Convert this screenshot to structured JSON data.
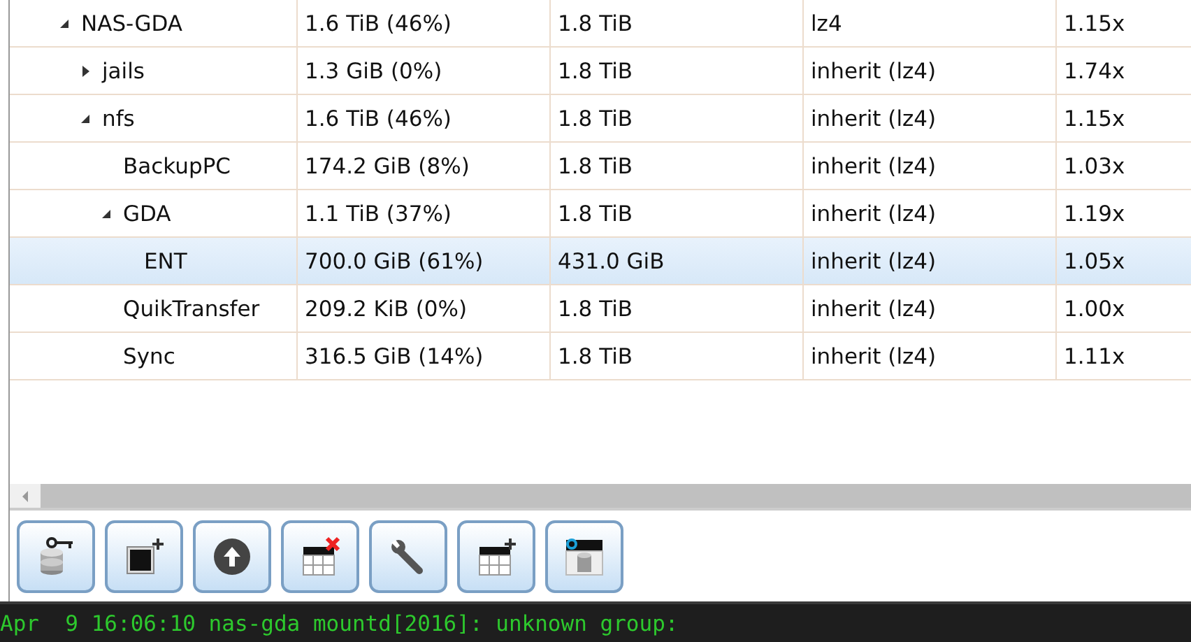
{
  "tree": [
    {
      "name": "NAS-GDA",
      "used": "1.6 TiB (46%)",
      "avail": "1.8 TiB",
      "compression": "lz4",
      "ratio": "1.15x",
      "selected": false,
      "expanded": true,
      "children": [
        {
          "name": "jails",
          "used": "1.3 GiB (0%)",
          "avail": "1.8 TiB",
          "compression": "inherit (lz4)",
          "ratio": "1.74x",
          "selected": false,
          "expanded": false
        },
        {
          "name": "nfs",
          "used": "1.6 TiB (46%)",
          "avail": "1.8 TiB",
          "compression": "inherit (lz4)",
          "ratio": "1.15x",
          "selected": false,
          "expanded": true,
          "children": [
            {
              "name": "BackupPC",
              "used": "174.2 GiB (8%)",
              "avail": "1.8 TiB",
              "compression": "inherit (lz4)",
              "ratio": "1.03x",
              "selected": false
            },
            {
              "name": "GDA",
              "used": "1.1 TiB (37%)",
              "avail": "1.8 TiB",
              "compression": "inherit (lz4)",
              "ratio": "1.19x",
              "selected": false,
              "expanded": true,
              "children": [
                {
                  "name": "ENT",
                  "used": "700.0 GiB (61%)",
                  "avail": "431.0 GiB",
                  "compression": "inherit (lz4)",
                  "ratio": "1.05x",
                  "selected": true
                }
              ]
            },
            {
              "name": "QuikTransfer",
              "used": "209.2 KiB (0%)",
              "avail": "1.8 TiB",
              "compression": "inherit (lz4)",
              "ratio": "1.00x",
              "selected": false
            },
            {
              "name": "Sync",
              "used": "316.5 GiB (14%)",
              "avail": "1.8 TiB",
              "compression": "inherit (lz4)",
              "ratio": "1.11x",
              "selected": false
            }
          ]
        }
      ]
    }
  ],
  "toolbar": [
    {
      "kind": "key-database"
    },
    {
      "kind": "square-plus"
    },
    {
      "kind": "upload"
    },
    {
      "kind": "table-delete"
    },
    {
      "kind": "wrench"
    },
    {
      "kind": "table-plus"
    },
    {
      "kind": "table-database"
    }
  ],
  "console": {
    "line": "Apr  9 16:06:10 nas-gda mountd[2016]: unknown group:"
  }
}
